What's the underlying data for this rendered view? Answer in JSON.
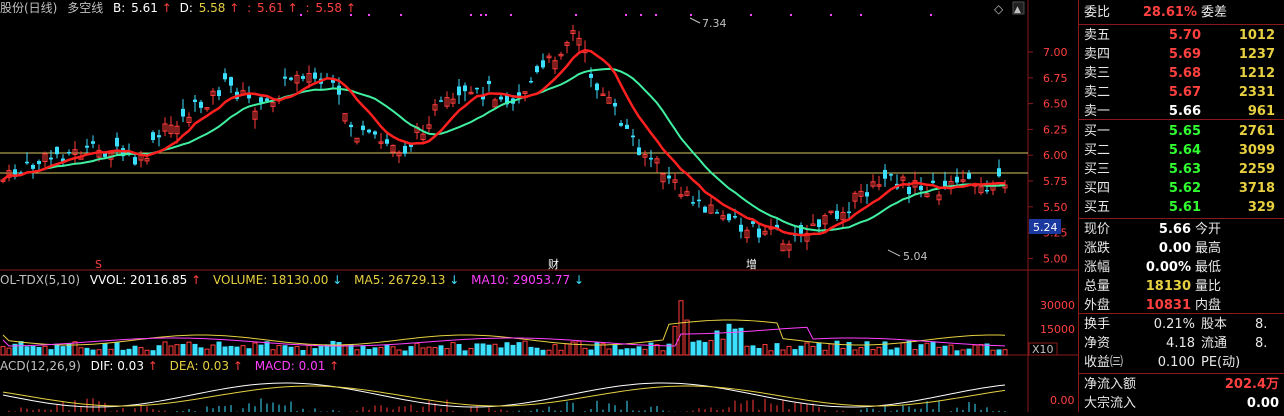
{
  "header": {
    "stock_name": "股份(日线)",
    "indicator": "多空线",
    "b_label": "B:",
    "b_value": "5.61",
    "d_label": "D:",
    "d_value": "5.58",
    "v1": "5.61",
    "v2": "5.58",
    "diamond": "◇"
  },
  "price_axis": {
    "ticks": [
      "7.00",
      "6.75",
      "6.50",
      "6.25",
      "6.00",
      "5.75",
      "5.50",
      "5.25",
      "5.00"
    ],
    "current_price_tag": "5.24"
  },
  "annotations": {
    "high": "7.34",
    "low": "5.04",
    "markers": [
      "S",
      "财",
      "增"
    ]
  },
  "volume_panel": {
    "title": "OL-TDX(5,10)",
    "vvol": "VVOL: 20116.85",
    "volume": "VOLUME: 18130.00",
    "ma5": "MA5: 26729.13",
    "ma10": "MA10: 29053.77",
    "ticks": [
      "30000",
      "15000"
    ],
    "unit": "X10"
  },
  "macd_panel": {
    "title": "ACD(12,26,9)",
    "dif": "DIF: 0.03",
    "dea": "DEA: 0.03",
    "macd": "MACD: 0.01",
    "tick": "0.00"
  },
  "quote": {
    "weibi_label": "委比",
    "weibi_value": "28.61%",
    "weicha_label": "委差",
    "asks": [
      {
        "label": "卖五",
        "price": "5.70",
        "vol": "1012"
      },
      {
        "label": "卖四",
        "price": "5.69",
        "vol": "1237"
      },
      {
        "label": "卖三",
        "price": "5.68",
        "vol": "1212"
      },
      {
        "label": "卖二",
        "price": "5.67",
        "vol": "2331"
      },
      {
        "label": "卖一",
        "price": "5.66",
        "vol": "961"
      }
    ],
    "bids": [
      {
        "label": "买一",
        "price": "5.65",
        "vol": "2761"
      },
      {
        "label": "买二",
        "price": "5.64",
        "vol": "3099"
      },
      {
        "label": "买三",
        "price": "5.63",
        "vol": "2259"
      },
      {
        "label": "买四",
        "price": "5.62",
        "vol": "3718"
      },
      {
        "label": "买五",
        "price": "5.61",
        "vol": "329"
      }
    ],
    "stats": [
      {
        "label": "现价",
        "value": "5.66",
        "label2": "今开"
      },
      {
        "label": "涨跌",
        "value": "0.00",
        "label2": "最高"
      },
      {
        "label": "涨幅",
        "value": "0.00%",
        "label2": "最低"
      },
      {
        "label": "总量",
        "value": "18130",
        "label2": "量比"
      },
      {
        "label": "外盘",
        "value": "10831",
        "label2": "内盘"
      }
    ],
    "stats2": [
      {
        "label": "换手",
        "value": "0.21%",
        "label2": "股本",
        "value2": "8."
      },
      {
        "label": "净资",
        "value": "4.18",
        "label2": "流通",
        "value2": "8."
      },
      {
        "label": "收益㈢",
        "value": "0.100",
        "label2": "PE(动)",
        "value2": ""
      }
    ],
    "flow": [
      {
        "label": "净流入额",
        "value": "202.4万"
      },
      {
        "label": "大宗流入",
        "value": "0.00"
      }
    ]
  },
  "colors": {
    "up": "#ff3c3c",
    "down": "#3ce0ff",
    "ma_red": "#ff2020",
    "ma_green": "#40f0a0",
    "axis": "#8a1a1a",
    "yellow": "#e6d040",
    "magenta": "#ff40ff"
  }
}
